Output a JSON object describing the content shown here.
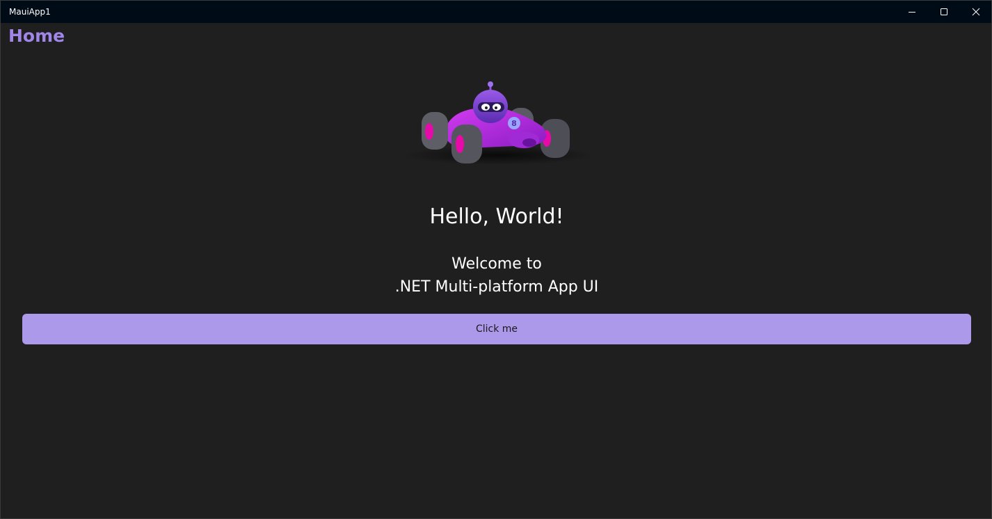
{
  "window": {
    "title": "MauiApp1",
    "caption_buttons": [
      {
        "name": "minimize-icon"
      },
      {
        "name": "maximize-icon"
      },
      {
        "name": "close-icon"
      }
    ]
  },
  "page": {
    "title": "Home",
    "hero_image": "dotnet-bot-race-car-image",
    "greeting": "Hello, World!",
    "welcome_line1": "Welcome to",
    "welcome_line2": ".NET Multi-platform App UI",
    "button_label": "Click me"
  },
  "colors": {
    "titlebar": "#000b18",
    "background": "#1f1f1f",
    "accent": "#a086e6",
    "button": "#ac99ea",
    "text": "#ffffff"
  }
}
